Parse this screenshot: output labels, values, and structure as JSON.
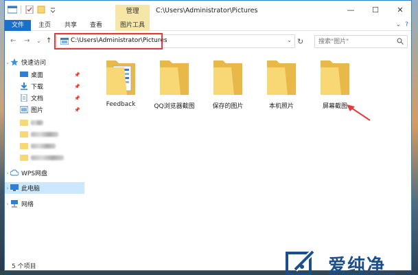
{
  "window": {
    "title": "C:\\Users\\Administrator\\Pictures",
    "context_tab": "管理",
    "controls": [
      "—",
      "☐",
      "✕"
    ]
  },
  "ribbon": {
    "tabs": [
      "文件",
      "主页",
      "共享",
      "查看",
      "图片工具"
    ],
    "expand_glyph": "⌄",
    "help_glyph": "?"
  },
  "address": {
    "path": "C:\\Users\\Administrator\\Pictures",
    "search_placeholder": "搜索\"图片\""
  },
  "nav_glyphs": {
    "back": "←",
    "forward": "→",
    "history": "⌄",
    "up": "↑",
    "refresh": "↻",
    "dropdown": "⌄",
    "chevron": "›",
    "pin": "📌"
  },
  "navpane": {
    "quick_access": "快速访问",
    "pinned": [
      "桌面",
      "下载",
      "文档",
      "图片"
    ],
    "wps": "WPS网盘",
    "this_pc": "此电脑",
    "network": "网络"
  },
  "folders": [
    "Feedback",
    "QQ浏览器截图",
    "保存的图片",
    "本机照片",
    "屏幕截图"
  ],
  "status": {
    "count": "5 个项目"
  },
  "colors": {
    "accent": "#1a6fc8",
    "context_tab": "#f6e7a9",
    "highlight": "#e23b3b",
    "folder": "#f8d775",
    "selected": "#cce8ff"
  }
}
